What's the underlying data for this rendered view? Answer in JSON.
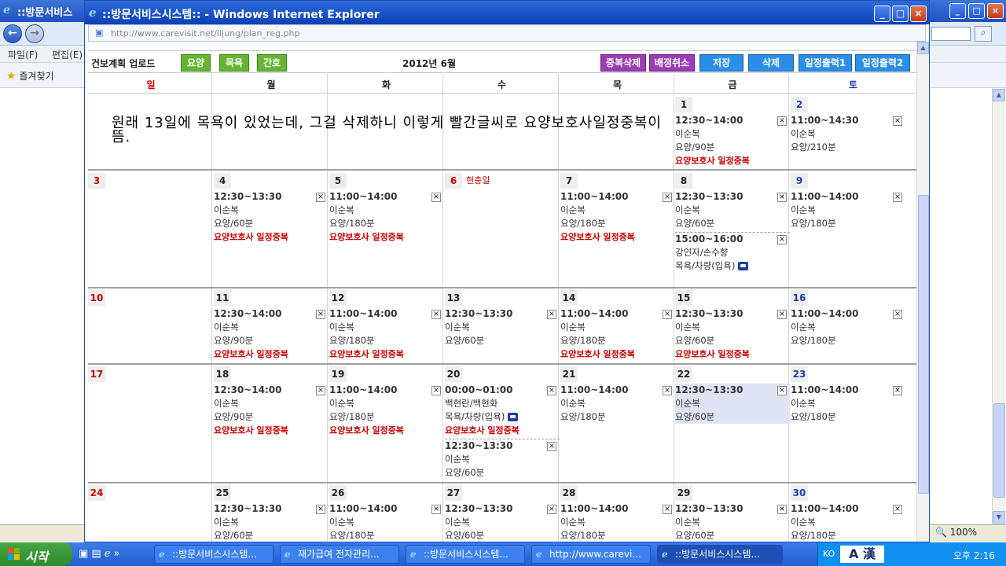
{
  "background_window": {
    "title": "::방문서비스",
    "menu": [
      "파일(F)",
      "편집(E)"
    ],
    "favorites": "즐겨찾기",
    "zoom": "100%"
  },
  "popup": {
    "title": "::방문서비스시스템:: - Windows Internet Explorer",
    "url": "http://www.carevisit.net/iljung/plan_reg.php"
  },
  "toolbar": {
    "upload_label": "건보계획 업로드",
    "btn_yoyang": "요양",
    "btn_mogyok": "목욕",
    "btn_ganho": "간호",
    "month_title": "2012년 6월",
    "btn_dup_delete": "중복삭제",
    "btn_assign_cancel": "배정취소",
    "btn_save": "저장",
    "btn_delete": "삭제",
    "btn_print1": "일정출력1",
    "btn_print2": "일정출력2"
  },
  "weekdays": [
    "일",
    "월",
    "화",
    "수",
    "목",
    "금",
    "토"
  ],
  "annotation": "원래 13일에 목욕이 있었는데, 그걸 삭제하니 이렇게 빨간글씨로 요양보호사일정중복이 뜸.",
  "days": {
    "d1": "1",
    "d2": "2",
    "d3": "3",
    "d4": "4",
    "d5": "5",
    "d6": "6",
    "d7": "7",
    "d8": "8",
    "d9": "9",
    "d10": "10",
    "d11": "11",
    "d12": "12",
    "d13": "13",
    "d14": "14",
    "d15": "15",
    "d16": "16",
    "d17": "17",
    "d18": "18",
    "d19": "19",
    "d20": "20",
    "d21": "21",
    "d22": "22",
    "d23": "23",
    "d24": "24",
    "d25": "25",
    "d26": "26",
    "d27": "27",
    "d28": "28",
    "d29": "29",
    "d30": "30",
    "holiday6": "현충일"
  },
  "entries": {
    "e1": {
      "time": "12:30~14:00",
      "who": "이순복",
      "svc": "요양/90분",
      "warn": "요양보호사 일정중복"
    },
    "e2": {
      "time": "11:00~14:30",
      "who": "이순복",
      "svc": "요양/210분"
    },
    "e4": {
      "time": "12:30~13:30",
      "who": "이순복",
      "svc": "요양/60분",
      "warn": "요양보호사 일정중복"
    },
    "e5": {
      "time": "11:00~14:00",
      "who": "이순복",
      "svc": "요양/180분",
      "warn": "요양보호사 일정중복"
    },
    "e7": {
      "time": "11:00~14:00",
      "who": "이순복",
      "svc": "요양/180분",
      "warn": "요양보호사 일정중복"
    },
    "e8a": {
      "time": "12:30~13:30",
      "who": "이순복",
      "svc": "요양/60분"
    },
    "e8b": {
      "time": "15:00~16:00",
      "who": "강인자/손수향",
      "svc": "목욕/차량(입욕)"
    },
    "e9": {
      "time": "11:00~14:00",
      "who": "이순복",
      "svc": "요양/180분"
    },
    "e11": {
      "time": "12:30~14:00",
      "who": "이순복",
      "svc": "요양/90분",
      "warn": "요양보호사 일정중복"
    },
    "e12": {
      "time": "11:00~14:00",
      "who": "이순복",
      "svc": "요양/180분",
      "warn": "요양보호사 일정중복"
    },
    "e13": {
      "time": "12:30~13:30",
      "who": "이순복",
      "svc": "요양/60분"
    },
    "e14": {
      "time": "11:00~14:00",
      "who": "이순복",
      "svc": "요양/180분",
      "warn": "요양보호사 일정중복"
    },
    "e15": {
      "time": "12:30~13:30",
      "who": "이순복",
      "svc": "요양/60분",
      "warn": "요양보호사 일정중복"
    },
    "e16": {
      "time": "11:00~14:00",
      "who": "이순복",
      "svc": "요양/180분"
    },
    "e18": {
      "time": "12:30~14:00",
      "who": "이순복",
      "svc": "요양/90분",
      "warn": "요양보호사 일정중복"
    },
    "e19": {
      "time": "11:00~14:00",
      "who": "이순복",
      "svc": "요양/180분",
      "warn": "요양보호사 일정중복"
    },
    "e20a": {
      "time": "00:00~01:00",
      "who": "백현란/백현화",
      "svc": "목욕/차량(입욕)",
      "warn": "요양보호사 일정중복"
    },
    "e20b": {
      "time": "12:30~13:30",
      "who": "이순복",
      "svc": "요양/60분"
    },
    "e21": {
      "time": "11:00~14:00",
      "who": "이순복",
      "svc": "요양/180분"
    },
    "e22": {
      "time": "12:30~13:30",
      "who": "이순복",
      "svc": "요양/60분"
    },
    "e23": {
      "time": "11:00~14:00",
      "who": "이순복",
      "svc": "요양/180분"
    },
    "e25": {
      "time": "12:30~13:30",
      "who": "이순복",
      "svc": "요양/60분"
    },
    "e26": {
      "time": "11:00~14:00",
      "who": "이순복",
      "svc": "요양/180분"
    },
    "e27": {
      "time": "12:30~13:30",
      "who": "이순복",
      "svc": "요양/60분"
    },
    "e28": {
      "time": "11:00~14:00",
      "who": "이순복",
      "svc": "요양/180분"
    },
    "e29": {
      "time": "12:30~13:30",
      "who": "이순복",
      "svc": "요양/60분"
    },
    "e30": {
      "time": "11:00~14:00",
      "who": "이순복",
      "svc": "요양/180분"
    }
  },
  "close_glyph": "×",
  "taskbar": {
    "start": "시작",
    "items": [
      "::방문서비스시스템...",
      "재가급여 전자관리...",
      "::방문서비스시스템...",
      "http://www.carevi...",
      "::방문서비스시스템..."
    ],
    "lang": "KO",
    "ime": "A 漢",
    "clock": "오후 2:16"
  }
}
